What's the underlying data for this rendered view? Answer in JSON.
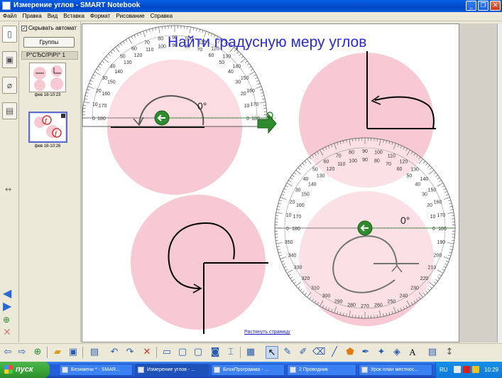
{
  "window": {
    "title": "Измерение углов - SMART Notebook",
    "minimize_glyph": "_",
    "maximize_glyph": "❐",
    "close_glyph": "✕"
  },
  "menu": [
    "Файл",
    "Правка",
    "Вид",
    "Вставка",
    "Формат",
    "Рисование",
    "Справка"
  ],
  "sorter": {
    "autohide_label": "Скрывать автомат",
    "autohide_checked": "✓",
    "groups_button": "Группы",
    "group_header": "Р°СЂСѓРїРї° 1",
    "pages": [
      {
        "caption": "фев 18-10:23"
      },
      {
        "caption": "фев 18-10:26"
      }
    ]
  },
  "canvas": {
    "heading": "Найти градусную меру углов",
    "stretch_link": "Растянуть страницу",
    "protractor1": {
      "outer_ticks": [
        "0",
        "10",
        "20",
        "30",
        "40",
        "50",
        "60",
        "70",
        "80",
        "90",
        "100",
        "110",
        "120",
        "130",
        "140",
        "150",
        "160",
        "170",
        "180"
      ],
      "inner_ticks": [
        "180",
        "170",
        "160",
        "150",
        "140",
        "130",
        "120",
        "110",
        "100",
        "90",
        "80",
        "70",
        "60",
        "50",
        "40",
        "30",
        "20",
        "10",
        "0"
      ],
      "angle_readout": "0°"
    },
    "protractor2": {
      "top_ticks": [
        "0",
        "10",
        "20",
        "30",
        "40",
        "50",
        "60",
        "70",
        "80",
        "90",
        "100",
        "110",
        "120",
        "130",
        "140",
        "150",
        "160",
        "170",
        "180"
      ],
      "bottom_ticks": [
        "190",
        "200",
        "210",
        "220",
        "230",
        "240",
        "250",
        "260",
        "270",
        "280",
        "290",
        "300",
        "310",
        "320",
        "330",
        "340",
        "350"
      ],
      "angle_readout": "0°"
    }
  },
  "colors": {
    "circle_fill": "#f7c9d2",
    "heading": "#2a2ad8",
    "handle_green": "#2e8b2e"
  },
  "taskbar": {
    "start_label": "пуск",
    "tasks": [
      {
        "label": "Безимени * - SMAR..."
      },
      {
        "label": "Измерение углов - ..."
      },
      {
        "label": "БлокПрограмма - ..."
      },
      {
        "label": "2 Проводник"
      },
      {
        "label": "Урок план местнос..."
      }
    ],
    "language": "RU",
    "clock": "10:29"
  }
}
